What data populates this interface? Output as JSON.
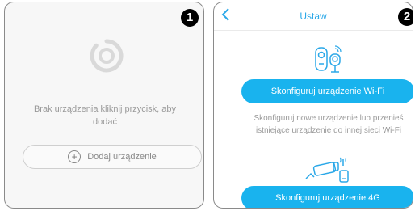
{
  "screen1": {
    "step_number": "1",
    "empty_message": "Brak urządzenia kliknij przycisk, aby dodać",
    "add_device_label": "Dodaj urządzenie",
    "plus_symbol": "+",
    "icons": [
      "empty-device-icon",
      "plus-icon"
    ]
  },
  "screen2": {
    "step_number": "2",
    "title": "Ustaw",
    "configure_wifi_label": "Skonfiguruj urządzenie Wi-Fi",
    "wifi_description": "Skonfiguruj nowe urządzenie lub przenieś istniejące urządzenie do innej sieci Wi-Fi",
    "configure_4g_label": "Skonfiguruj urządzenie 4G",
    "icons": [
      "back-icon",
      "wifi-camera-icon",
      "4g-camera-icon"
    ]
  },
  "colors": {
    "accent": "#19b3ee",
    "title_color": "#2ba8e8",
    "muted_text": "#9a9a9a",
    "screen_bg": "#f7f7f7"
  }
}
